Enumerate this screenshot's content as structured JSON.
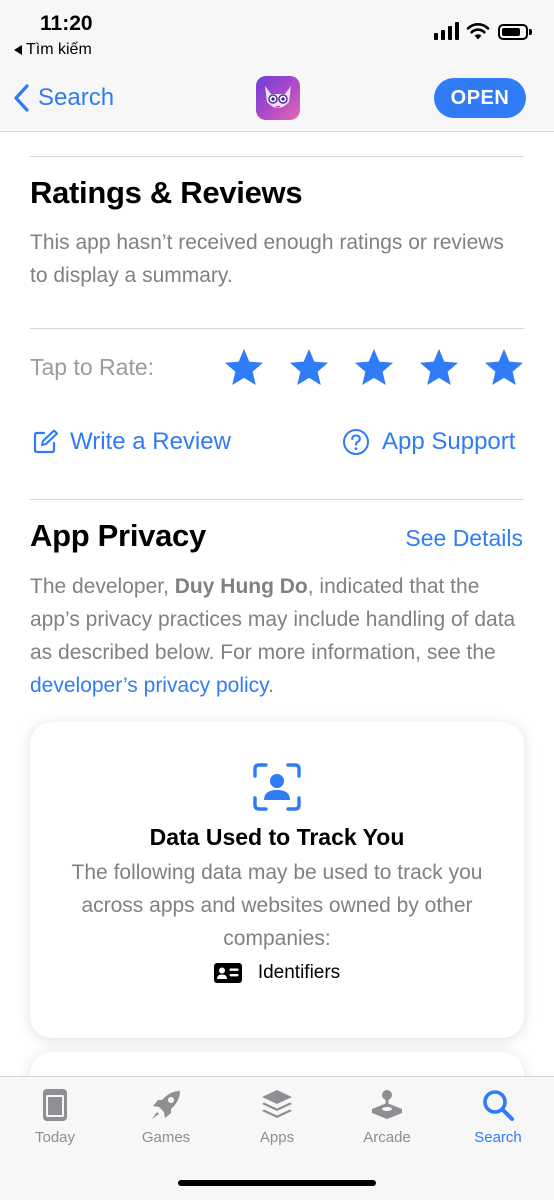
{
  "status_bar": {
    "time": "11:20",
    "back_app": "Tìm kiếm"
  },
  "nav": {
    "back_label": "Search",
    "open_label": "OPEN"
  },
  "ratings": {
    "title": "Ratings & Reviews",
    "message": "This app hasn’t received enough ratings or reviews to display a summary.",
    "tap_to_rate": "Tap to Rate:",
    "star_count": 5,
    "write_review": "Write a Review",
    "app_support": "App Support"
  },
  "privacy": {
    "title": "App Privacy",
    "see_details": "See Details",
    "para_prefix": "The developer, ",
    "developer": "Duy Hung Do",
    "para_middle": ", indicated that the app’s privacy practices may include handling of data as described below. For more information, see the ",
    "policy_link": "developer’s privacy policy",
    "para_suffix": ".",
    "card": {
      "title": "Data Used to Track You",
      "description": "The following data may be used to track you across apps and websites owned by other companies:",
      "item": "Identifiers"
    }
  },
  "tabs": [
    {
      "label": "Today",
      "icon": "today-icon",
      "active": false
    },
    {
      "label": "Games",
      "icon": "rocket-icon",
      "active": false
    },
    {
      "label": "Apps",
      "icon": "layers-icon",
      "active": false
    },
    {
      "label": "Arcade",
      "icon": "joystick-icon",
      "active": false
    },
    {
      "label": "Search",
      "icon": "search-icon",
      "active": true
    }
  ],
  "colors": {
    "accent": "#2f7cf6",
    "secondary_text": "#808085"
  }
}
